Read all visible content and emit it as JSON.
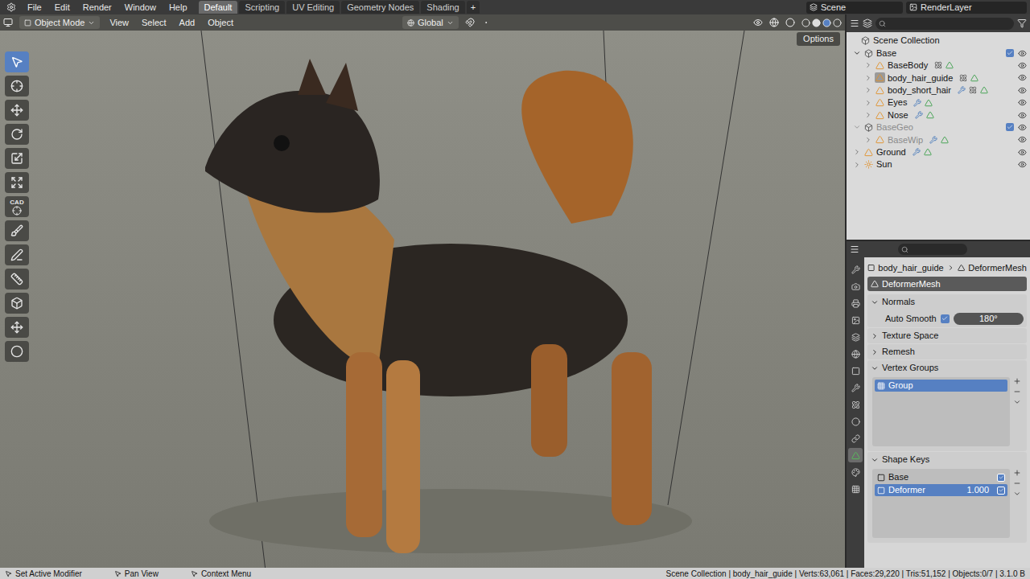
{
  "menu": [
    "File",
    "Edit",
    "Render",
    "Window",
    "Help"
  ],
  "workspaces": [
    {
      "label": "Default",
      "selected": true
    },
    {
      "label": "Scripting",
      "selected": false
    },
    {
      "label": "UV Editing",
      "selected": false
    },
    {
      "label": "Geometry Nodes",
      "selected": false
    },
    {
      "label": "Shading",
      "selected": false
    }
  ],
  "add_workspace": "+",
  "scene": "Scene",
  "view_layer": "RenderLayer",
  "viewport_header": {
    "mode": "Object Mode",
    "menus": [
      "View",
      "Select",
      "Add",
      "Object"
    ],
    "orientation": "Global",
    "options": "Options"
  },
  "tools": [
    {
      "name": "select",
      "selected": true
    },
    {
      "name": "cursor",
      "selected": false
    },
    {
      "name": "move",
      "selected": false
    },
    {
      "name": "rotate",
      "selected": false
    },
    {
      "name": "scale",
      "selected": false
    },
    {
      "name": "transform",
      "selected": false
    },
    {
      "name": "cad",
      "label": "CAD",
      "selected": false
    },
    {
      "name": "hair",
      "selected": false
    },
    {
      "name": "annotate",
      "selected": false
    },
    {
      "name": "measure",
      "selected": false
    },
    {
      "name": "add-cube",
      "selected": false
    },
    {
      "name": "move-view",
      "selected": false
    },
    {
      "name": "orbit",
      "selected": false
    }
  ],
  "outliner": {
    "root": "Scene Collection",
    "items": [
      {
        "label": "Base",
        "kind": "collection",
        "depth": 0,
        "expanded": true,
        "checked": true,
        "disabled": false,
        "active": false,
        "modifiers": false,
        "particles": false,
        "mesh": false,
        "visible": true
      },
      {
        "label": "BaseBody",
        "kind": "object",
        "depth": 1,
        "expanded": false,
        "disabled": false,
        "active": false,
        "modifiers": false,
        "particles": true,
        "mesh": true,
        "visible": true
      },
      {
        "label": "body_hair_guide",
        "kind": "object",
        "depth": 1,
        "expanded": false,
        "disabled": false,
        "active": true,
        "modifiers": false,
        "particles": true,
        "mesh": true,
        "visible": true
      },
      {
        "label": "body_short_hair",
        "kind": "object",
        "depth": 1,
        "expanded": false,
        "disabled": false,
        "active": false,
        "modifiers": true,
        "particles": true,
        "mesh": true,
        "visible": true
      },
      {
        "label": "Eyes",
        "kind": "object",
        "depth": 1,
        "expanded": false,
        "disabled": false,
        "active": false,
        "modifiers": true,
        "particles": false,
        "mesh": true,
        "visible": true
      },
      {
        "label": "Nose",
        "kind": "object",
        "depth": 1,
        "expanded": false,
        "disabled": false,
        "active": false,
        "modifiers": true,
        "particles": false,
        "mesh": true,
        "visible": true
      },
      {
        "label": "BaseGeo",
        "kind": "collection",
        "depth": 0,
        "expanded": true,
        "checked": true,
        "disabled": true,
        "active": false,
        "modifiers": false,
        "particles": false,
        "mesh": false,
        "visible": true
      },
      {
        "label": "BaseWip",
        "kind": "object",
        "depth": 1,
        "expanded": false,
        "disabled": true,
        "active": false,
        "modifiers": true,
        "particles": false,
        "mesh": true,
        "visible": true
      },
      {
        "label": "Ground",
        "kind": "object",
        "depth": 0,
        "expanded": false,
        "disabled": false,
        "active": false,
        "modifiers": true,
        "particles": false,
        "mesh": true,
        "visible": true
      },
      {
        "label": "Sun",
        "kind": "light",
        "depth": 0,
        "expanded": false,
        "disabled": false,
        "active": false,
        "modifiers": false,
        "particles": false,
        "mesh": false,
        "visible": true
      }
    ]
  },
  "property_tabs": [
    {
      "name": "tool",
      "selected": false
    },
    {
      "name": "render",
      "selected": false
    },
    {
      "name": "output",
      "selected": false
    },
    {
      "name": "view-layer",
      "selected": false
    },
    {
      "name": "scene",
      "selected": false
    },
    {
      "name": "world",
      "selected": false
    },
    {
      "name": "object",
      "selected": false
    },
    {
      "name": "modifiers",
      "selected": false
    },
    {
      "name": "particles",
      "selected": false
    },
    {
      "name": "physics",
      "selected": false
    },
    {
      "name": "constraints",
      "selected": false
    },
    {
      "name": "data",
      "selected": true
    },
    {
      "name": "material",
      "selected": false
    },
    {
      "name": "texture",
      "selected": false
    }
  ],
  "properties": {
    "breadcrumb": [
      "body_hair_guide",
      "DeformerMesh"
    ],
    "datablock": "DeformerMesh",
    "panels": [
      {
        "title": "Normals",
        "kind": "normals",
        "expanded": true,
        "auto_smooth": {
          "label": "Auto Smooth",
          "checked": true,
          "value": "180°"
        }
      },
      {
        "title": "Texture Space",
        "kind": "plain",
        "expanded": false
      },
      {
        "title": "Remesh",
        "kind": "plain",
        "expanded": false
      },
      {
        "title": "Vertex Groups",
        "kind": "vertex_groups",
        "expanded": true,
        "items": [
          {
            "name": "Group",
            "selected": true
          }
        ]
      },
      {
        "title": "Shape Keys",
        "kind": "shape_keys",
        "expanded": true,
        "items": [
          {
            "name": "Base",
            "value": "",
            "checked": true,
            "selected": false
          },
          {
            "name": "Deformer",
            "value": "1.000",
            "checked": true,
            "selected": true
          }
        ]
      }
    ]
  },
  "status_bar": {
    "hints": [
      "Set Active Modifier",
      "Pan View",
      "Context Menu"
    ],
    "stats": "Scene Collection | body_hair_guide | Verts:63,061 | Faces:29,220 | Tris:51,152 | Objects:0/7 | 3.1.0 B"
  }
}
